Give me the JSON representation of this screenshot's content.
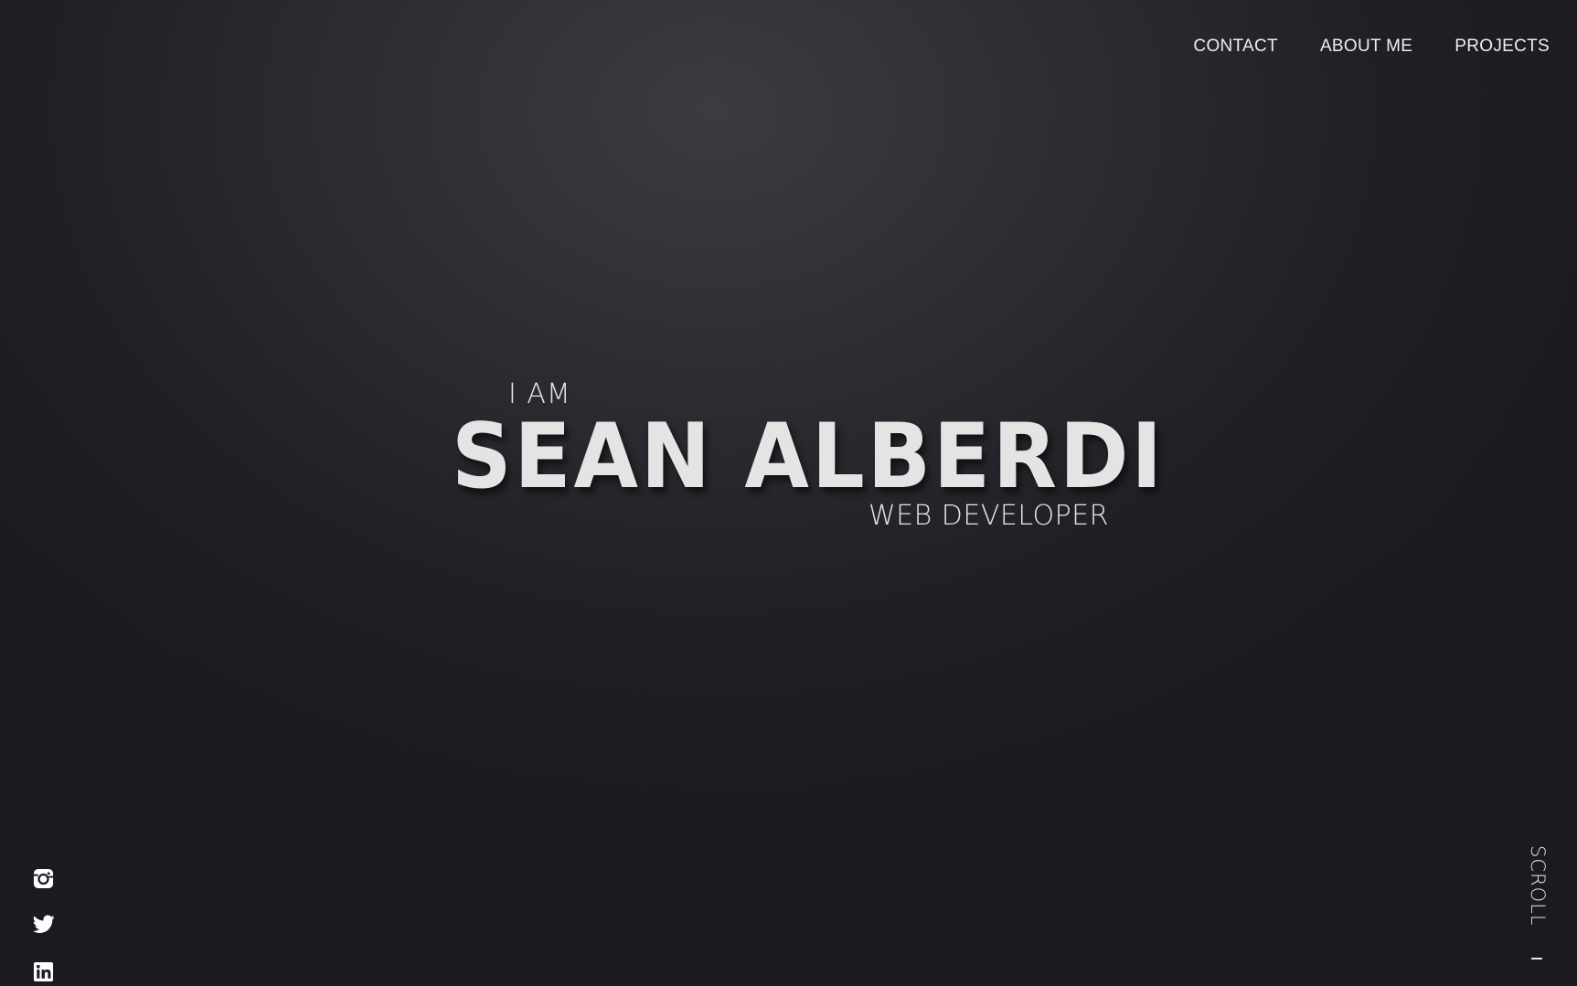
{
  "nav": {
    "items": [
      {
        "label": "CONTACT"
      },
      {
        "label": "ABOUT ME"
      },
      {
        "label": "PROJECTS"
      }
    ]
  },
  "hero": {
    "pre": "I AM",
    "name": "SEAN ALBERDI",
    "role": "WEB DEVELOPER"
  },
  "social": {
    "icons": [
      "instagram-icon",
      "twitter-icon",
      "linkedin-icon"
    ]
  },
  "scroll": {
    "label": "SCROLL"
  },
  "colors": {
    "background_dark": "#1a1b20",
    "background_light": "#3b3c41",
    "text": "#e4e4e4"
  }
}
